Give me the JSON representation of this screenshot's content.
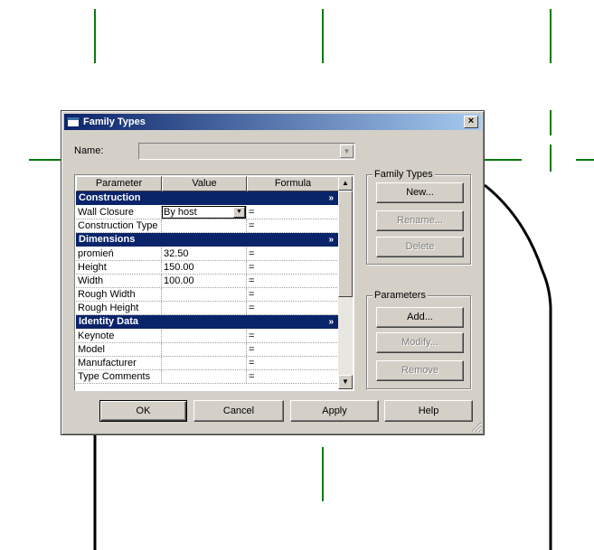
{
  "dialog": {
    "title": "Family Types",
    "close_label": "×",
    "name_label": "Name:",
    "name_value": ""
  },
  "grid": {
    "headers": [
      "Parameter",
      "Value",
      "Formula"
    ],
    "groups": [
      {
        "label": "Construction",
        "rows": [
          {
            "param": "Wall Closure",
            "value": "By host",
            "formula": "="
          },
          {
            "param": "Construction Type",
            "value": "",
            "formula": "="
          }
        ]
      },
      {
        "label": "Dimensions",
        "rows": [
          {
            "param": "promień",
            "value": "32.50",
            "formula": "="
          },
          {
            "param": "Height",
            "value": "150.00",
            "formula": "="
          },
          {
            "param": "Width",
            "value": "100.00",
            "formula": "="
          },
          {
            "param": "Rough Width",
            "value": "",
            "formula": "="
          },
          {
            "param": "Rough Height",
            "value": "",
            "formula": "="
          }
        ]
      },
      {
        "label": "Identity Data",
        "rows": [
          {
            "param": "Keynote",
            "value": "",
            "formula": "="
          },
          {
            "param": "Model",
            "value": "",
            "formula": "="
          },
          {
            "param": "Manufacturer",
            "value": "",
            "formula": "="
          },
          {
            "param": "Type Comments",
            "value": "",
            "formula": "="
          }
        ]
      }
    ],
    "collapse_glyph": "»"
  },
  "family_types_box": {
    "legend": "Family Types",
    "new_label": "New...",
    "rename_label": "Rename...",
    "delete_label": "Delete"
  },
  "parameters_box": {
    "legend": "Parameters",
    "add_label": "Add...",
    "modify_label": "Modify...",
    "remove_label": "Remove"
  },
  "footer": {
    "ok_label": "OK",
    "cancel_label": "Cancel",
    "apply_label": "Apply",
    "help_label": "Help"
  },
  "colors": {
    "title_bar": "#0a246a",
    "dialog_bg": "#d4d0c8",
    "cad_green": "#0a7a0a"
  }
}
